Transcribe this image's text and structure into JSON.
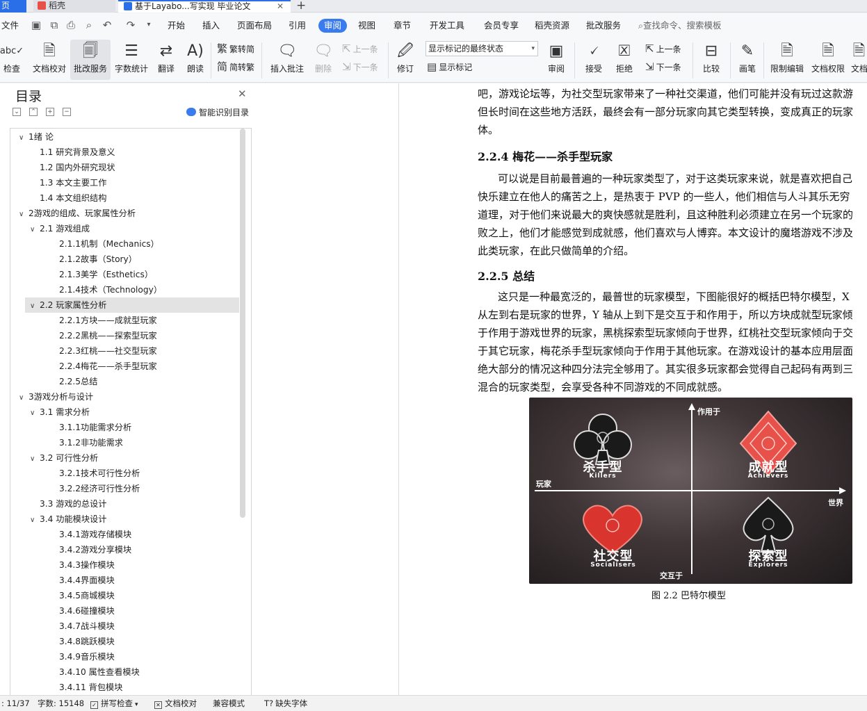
{
  "tabs": {
    "home": "页",
    "docer": "稻壳",
    "document": "基于Layabo...写实现 毕业论文"
  },
  "menu": {
    "file": "文件",
    "items": [
      "开始",
      "插入",
      "页面布局",
      "引用",
      "审阅",
      "视图",
      "章节",
      "开发工具",
      "会员专享",
      "稻壳资源",
      "批改服务"
    ],
    "active": "审阅",
    "search": "查找命令、搜索模板"
  },
  "ribbon": {
    "spell": "检查",
    "proofread": "文档校对",
    "correction_service": "批改服务",
    "word_count": "字数统计",
    "translate": "翻译",
    "read_aloud": "朗读",
    "trad": "繁转简",
    "simp": "简转繁",
    "insert_comment": "插入批注",
    "delete": "删除",
    "prev": "上一条",
    "next": "下一条",
    "track": "修订",
    "markup_mode": "显示标记的最终状态",
    "show_markup": "显示标记",
    "review": "审阅",
    "accept": "接受",
    "reject": "拒绝",
    "prev2": "上一条",
    "next2": "下一条",
    "compare": "比较",
    "ink": "画笔",
    "restrict": "限制编辑",
    "doc_perm": "文档权限",
    "doc_partial": "文档"
  },
  "toc": {
    "title": "目录",
    "smart": "智能识别目录",
    "items": [
      {
        "text": "1绪 论",
        "level": 1,
        "chev": "∨"
      },
      {
        "text": "1.1  研究背景及意义",
        "level": 2,
        "chev": ""
      },
      {
        "text": "1.2  国内外研究现状",
        "level": 2,
        "chev": ""
      },
      {
        "text": "1.3  本文主要工作",
        "level": 2,
        "chev": ""
      },
      {
        "text": "1.4  本文组织结构",
        "level": 2,
        "chev": ""
      },
      {
        "text": "2游戏的组成、玩家属性分析",
        "level": 1,
        "chev": "∨"
      },
      {
        "text": "2.1  游戏组成",
        "level": 2,
        "chev": "∨"
      },
      {
        "text": "2.1.1机制（Mechanics）",
        "level": 3,
        "chev": ""
      },
      {
        "text": "2.1.2故事（Story）",
        "level": 3,
        "chev": ""
      },
      {
        "text": "2.1.3美学（Esthetics）",
        "level": 3,
        "chev": ""
      },
      {
        "text": "2.1.4技术（Technology）",
        "level": 3,
        "chev": ""
      },
      {
        "text": "2.2  玩家属性分析",
        "level": 2,
        "chev": "∨",
        "selected": true
      },
      {
        "text": "2.2.1方块——成就型玩家",
        "level": 3,
        "chev": ""
      },
      {
        "text": "2.2.2黑桃——探索型玩家",
        "level": 3,
        "chev": ""
      },
      {
        "text": "2.2.3红桃——社交型玩家",
        "level": 3,
        "chev": ""
      },
      {
        "text": "2.2.4梅花——杀手型玩家",
        "level": 3,
        "chev": ""
      },
      {
        "text": "2.2.5总结",
        "level": 3,
        "chev": ""
      },
      {
        "text": "3游戏分析与设计",
        "level": 1,
        "chev": "∨"
      },
      {
        "text": "3.1  需求分析",
        "level": 2,
        "chev": "∨"
      },
      {
        "text": "3.1.1功能需求分析",
        "level": 3,
        "chev": ""
      },
      {
        "text": "3.1.2非功能需求",
        "level": 3,
        "chev": ""
      },
      {
        "text": "3.2  可行性分析",
        "level": 2,
        "chev": "∨"
      },
      {
        "text": "3.2.1技术可行性分析",
        "level": 3,
        "chev": ""
      },
      {
        "text": "3.2.2经济可行性分析",
        "level": 3,
        "chev": ""
      },
      {
        "text": "3.3  游戏的总设计",
        "level": 2,
        "chev": ""
      },
      {
        "text": "3.4  功能模块设计",
        "level": 2,
        "chev": "∨"
      },
      {
        "text": "3.4.1游戏存储模块",
        "level": 3,
        "chev": ""
      },
      {
        "text": "3.4.2游戏分享模块",
        "level": 3,
        "chev": ""
      },
      {
        "text": "3.4.3操作模块",
        "level": 3,
        "chev": ""
      },
      {
        "text": "3.4.4界面模块",
        "level": 3,
        "chev": ""
      },
      {
        "text": "3.4.5商城模块",
        "level": 3,
        "chev": ""
      },
      {
        "text": "3.4.6碰撞模块",
        "level": 3,
        "chev": ""
      },
      {
        "text": "3.4.7战斗模块",
        "level": 3,
        "chev": ""
      },
      {
        "text": "3.4.8跳跃模块",
        "level": 3,
        "chev": ""
      },
      {
        "text": "3.4.9音乐模块",
        "level": 3,
        "chev": ""
      },
      {
        "text": "3.4.10  属性查看模块",
        "level": 3,
        "chev": ""
      },
      {
        "text": "3.4.11  背包模块",
        "level": 3,
        "chev": ""
      }
    ]
  },
  "doc": {
    "p1": [
      "吧，游戏论坛等，为社交型玩家带来了一种社交渠道，他们可能并没有玩过这款游",
      "但长时间在这些地方活跃，最终会有一部分玩家向其它类型转换，变成真正的玩家",
      "体。"
    ],
    "h224": "2.2.4  梅花——杀手型玩家",
    "p2": [
      "可以说是目前最普遍的一种玩家类型了，对于这类玩家来说，就是喜欢把自己",
      "快乐建立在他人的痛苦之上，是热衷于 PVP 的一些人，他们相信与人斗其乐无穷",
      "道理，对于他们来说最大的爽快感就是胜利，且这种胜利必须建立在另一个玩家的",
      "败之上，他们才能感觉到成就感，他们喜欢与人博弈。本文设计的魔塔游戏不涉及",
      "此类玩家，在此只做简单的介绍。"
    ],
    "h225": "2.2.5  总结",
    "p3": [
      "这只是一种最宽泛的，最普世的玩家模型，下图能很好的概括巴特尔模型，X",
      "从左到右是玩家的世界，Y 轴从上到下是交互于和作用于，所以方块成就型玩家倾",
      "于作用于游戏世界的玩家，黑桃探索型玩家倾向于世界，红桃社交型玩家倾向于交",
      "于其它玩家，梅花杀手型玩家倾向于作用于其他玩家。在游戏设计的基本应用层面",
      "绝大部分的情况这种四分法完全够用了。其实很多玩家都会觉得自己起码有两到三",
      "混合的玩家类型，会享受各种不同游戏的不同成就感。"
    ],
    "figure": {
      "axis_top": "作用于",
      "axis_bottom": "交互于",
      "axis_left": "玩家",
      "axis_right": "世界",
      "killers_cn": "杀手型",
      "killers_en": "Killers",
      "achievers_cn": "成就型",
      "achievers_en": "Achievers",
      "socialisers_cn": "社交型",
      "socialisers_en": "Socialisers",
      "explorers_cn": "探索型",
      "explorers_en": "Explorers"
    },
    "caption": "图 2.2 巴特尔模型"
  },
  "status": {
    "page": ": 11/37",
    "words": "字数: 15148",
    "spell": "拼写检查",
    "proof": "文档校对",
    "compat": "兼容模式",
    "missing_font": "缺失字体"
  },
  "colors": {
    "accent": "#3a7cf0",
    "diamond": "#e8504a",
    "heart": "#d9342e"
  }
}
